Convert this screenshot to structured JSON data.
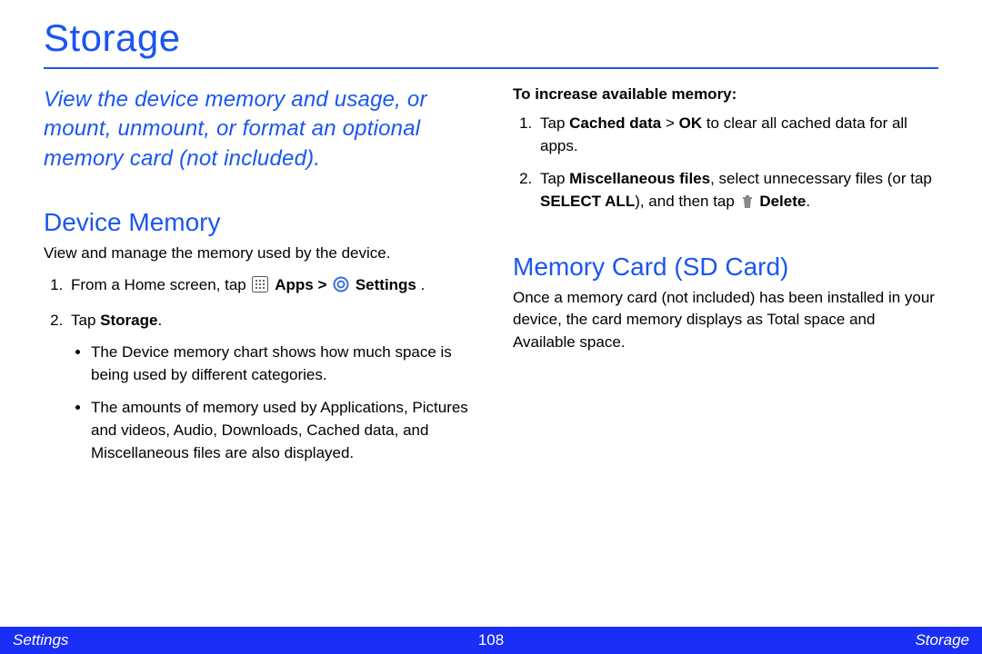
{
  "title": "Storage",
  "intro": "View the device memory and usage, or mount, unmount, or format an optional memory card (not included).",
  "deviceMemory": {
    "heading": "Device Memory",
    "desc": "View and manage the memory used by the device.",
    "step1_prefix": "From a Home screen, tap ",
    "step1_apps": "Apps",
    "step1_sep": " > ",
    "step1_settings": "Settings",
    "step1_suffix": ".",
    "step2_prefix": "Tap ",
    "step2_bold": "Storage",
    "step2_suffix": ".",
    "bullet1": "The Device memory chart shows how much space is being used by different categories.",
    "bullet2": "The amounts of memory used by Applications, Pictures and videos, Audio, Downloads, Cached data, and Miscellaneous files are also displayed."
  },
  "increaseMemory": {
    "heading": "To increase available memory:",
    "step1_prefix": "Tap ",
    "step1_b1": "Cached data",
    "step1_mid": " > ",
    "step1_b2": "OK",
    "step1_suffix": " to clear all cached data for all apps.",
    "step2_prefix": "Tap ",
    "step2_b1": "Miscellaneous files",
    "step2_mid1": ", select unnecessary files (or tap ",
    "step2_b2": "SELECT ALL",
    "step2_mid2": "), and then tap ",
    "step2_b3": "Delete",
    "step2_suffix": "."
  },
  "sdCard": {
    "heading": "Memory Card (SD Card)",
    "desc": "Once a memory card (not included) has been installed in your device, the card memory displays as Total space and Available space."
  },
  "footer": {
    "left": "Settings",
    "center": "108",
    "right": "Storage"
  }
}
